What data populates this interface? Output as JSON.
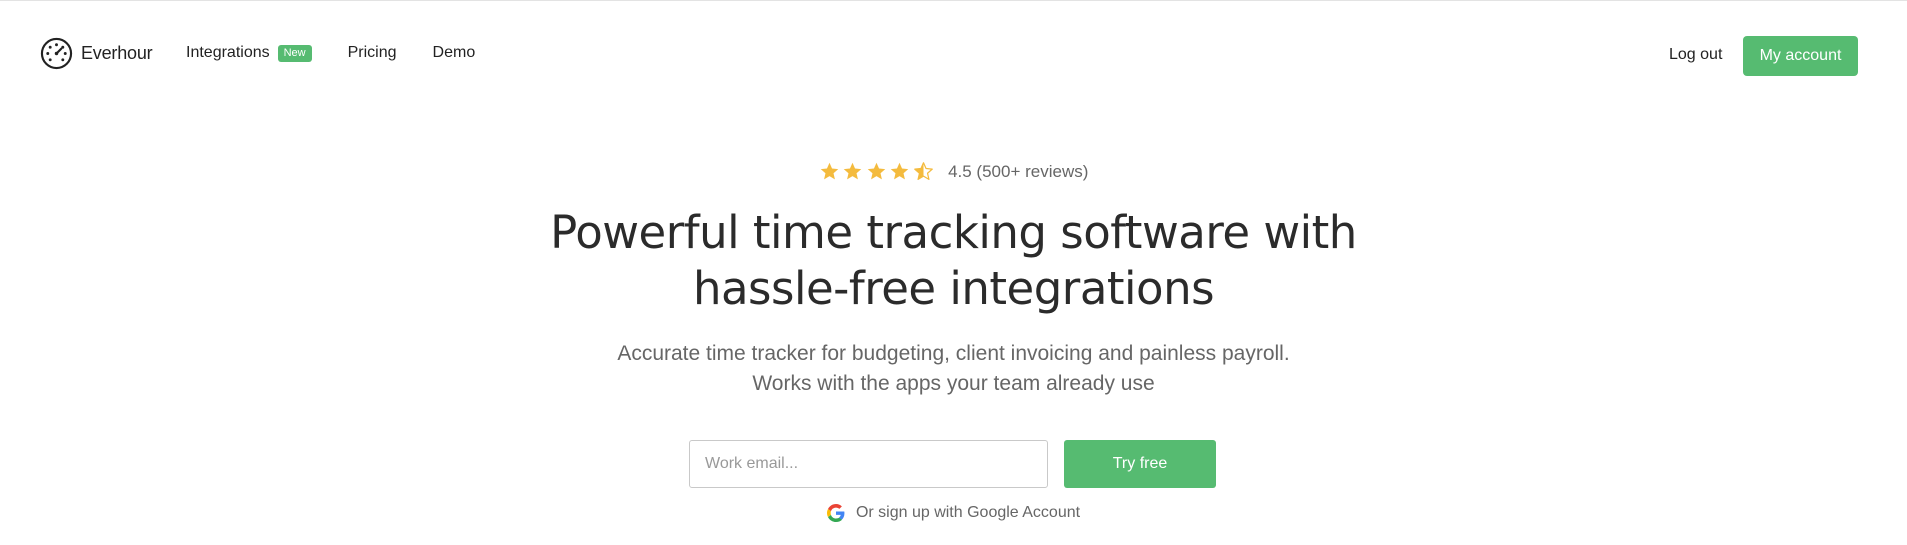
{
  "brand": {
    "name": "Everhour",
    "accent_color": "#56bb71",
    "star_color": "#f4bb3e"
  },
  "nav": {
    "items": [
      {
        "label": "Integrations",
        "badge": "New"
      },
      {
        "label": "Pricing"
      },
      {
        "label": "Demo"
      }
    ],
    "logout_label": "Log out",
    "account_label": "My account"
  },
  "hero": {
    "rating": {
      "value": 4.5,
      "max": 5,
      "text": "4.5 (500+ reviews)"
    },
    "headline_line1": "Powerful time tracking software with",
    "headline_line2": "hassle-free integrations",
    "subhead_line1": "Accurate time tracker for budgeting, client invoicing and painless payroll.",
    "subhead_line2": "Works with the apps your team already use",
    "email_placeholder": "Work email...",
    "cta_label": "Try free",
    "google_label": "Or sign up with Google Account"
  },
  "icons": [
    "everhour-logo-icon",
    "star-icon",
    "half-star-icon",
    "google-icon"
  ]
}
